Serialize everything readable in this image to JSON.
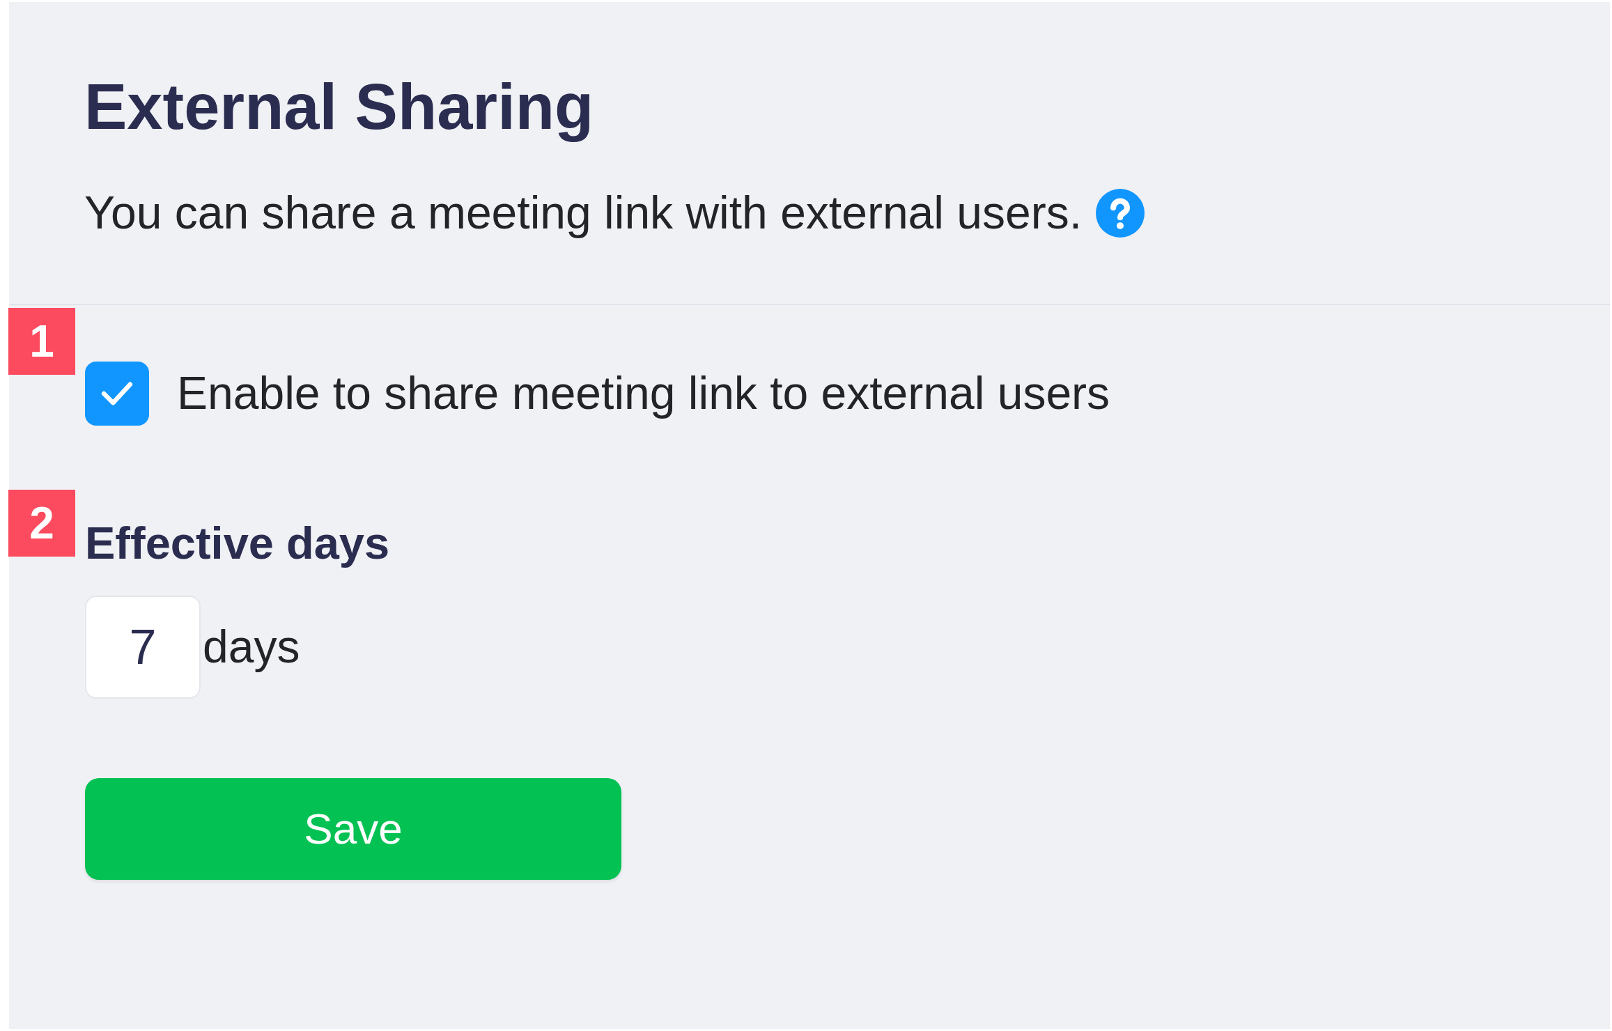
{
  "page": {
    "title": "External Sharing",
    "description": "You can share a meeting link with external users."
  },
  "share_option": {
    "marker": "1",
    "label": "Enable to share meeting link to external users",
    "checked": true
  },
  "effective_days": {
    "marker": "2",
    "label": "Effective days",
    "value": "7",
    "unit": "days"
  },
  "buttons": [
    {
      "label": "Save"
    }
  ]
}
